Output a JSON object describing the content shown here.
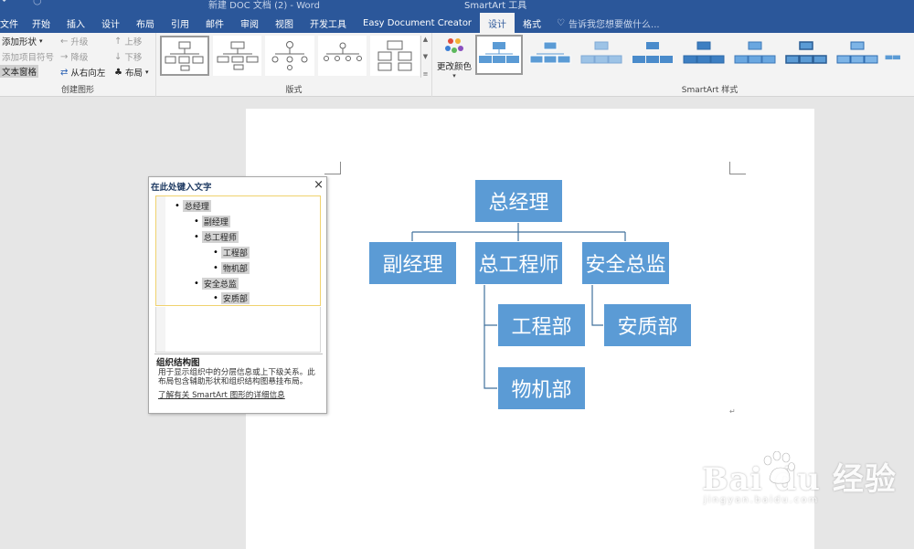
{
  "window": {
    "title": "新建 DOC 文档 (2) - Word",
    "tools_title": "SmartArt 工具"
  },
  "tabs": [
    {
      "label": "文件"
    },
    {
      "label": "开始"
    },
    {
      "label": "插入"
    },
    {
      "label": "设计"
    },
    {
      "label": "布局"
    },
    {
      "label": "引用"
    },
    {
      "label": "邮件"
    },
    {
      "label": "审阅"
    },
    {
      "label": "视图"
    },
    {
      "label": "开发工具"
    },
    {
      "label": "Easy Document Creator"
    },
    {
      "label": "设计",
      "active": true
    },
    {
      "label": "格式"
    }
  ],
  "tell_me": "告诉我您想要做什么...",
  "ribbon": {
    "create_graphic": {
      "label": "创建图形",
      "add_shape": "添加形状",
      "add_bullet": "添加项目符号",
      "text_pane": "文本窗格",
      "promote": "升级",
      "demote": "降级",
      "right_to_left": "从右向左",
      "move_up": "上移",
      "move_down": "下移",
      "layout": "布局"
    },
    "layouts": {
      "label": "版式"
    },
    "smartart_styles": {
      "label": "SmartArt 样式",
      "change_colors": "更改颜色"
    }
  },
  "text_pane": {
    "title": "在此处键入文字",
    "items": [
      {
        "text": "总经理",
        "level": 1
      },
      {
        "text": "副经理",
        "level": 2
      },
      {
        "text": "总工程师",
        "level": 2
      },
      {
        "text": "工程部",
        "level": 3
      },
      {
        "text": "物机部",
        "level": 3
      },
      {
        "text": "安全总监",
        "level": 2
      },
      {
        "text": "安质部",
        "level": 3
      }
    ],
    "info_title": "组织结构图",
    "info_desc": "用于显示组织中的分层信息或上下级关系。此布局包含辅助形状和组织结构图悬挂布局。",
    "info_link": "了解有关 SmartArt 图形的详细信息"
  },
  "org_chart": {
    "box_color": "#5b9bd5",
    "root": "总经理",
    "vice": "副经理",
    "chief_engineer": "总工程师",
    "safety_director": "安全总监",
    "engineering_dept": "工程部",
    "equipment_dept": "物机部",
    "quality_dept": "安质部"
  },
  "watermark": {
    "main": "Bai du 经验",
    "sub": "jingyan.baidu.com"
  },
  "colors": {
    "ribbon_blue": "#2b579a",
    "accent": "#5b9bd5"
  }
}
